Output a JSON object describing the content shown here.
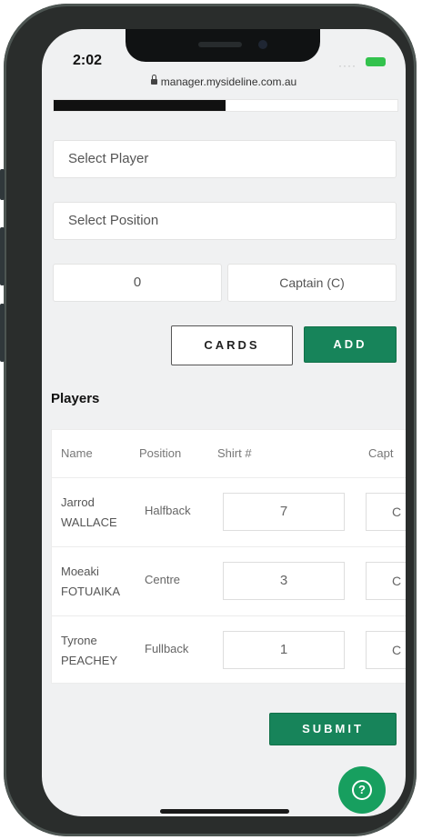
{
  "status_bar": {
    "time": "2:02"
  },
  "browser": {
    "url": "manager.mysideline.com.au"
  },
  "progress": {
    "fraction": 0.5
  },
  "form": {
    "select_player_placeholder": "Select Player",
    "select_position_placeholder": "Select Position",
    "shirt_number_value": "0",
    "captain_option": "Captain (C)",
    "cards_button": "CARDS",
    "add_button": "ADD"
  },
  "players": {
    "section_title": "Players",
    "columns": [
      "Name",
      "Position",
      "Shirt #",
      "Capt"
    ],
    "rows": [
      {
        "first_name": "Jarrod",
        "last_name": "WALLACE",
        "position": "Halfback",
        "shirt": "7",
        "capt": "C"
      },
      {
        "first_name": "Moeaki",
        "last_name": "FOTUAIKA",
        "position": "Centre",
        "shirt": "3",
        "capt": "C"
      },
      {
        "first_name": "Tyrone",
        "last_name": "PEACHEY",
        "position": "Fullback",
        "shirt": "1",
        "capt": "C"
      }
    ]
  },
  "submit_button": "SUBMIT",
  "help_button": {
    "icon": "question-icon"
  },
  "colors": {
    "brand_green": "#17845a",
    "help_green": "#179f5f"
  }
}
